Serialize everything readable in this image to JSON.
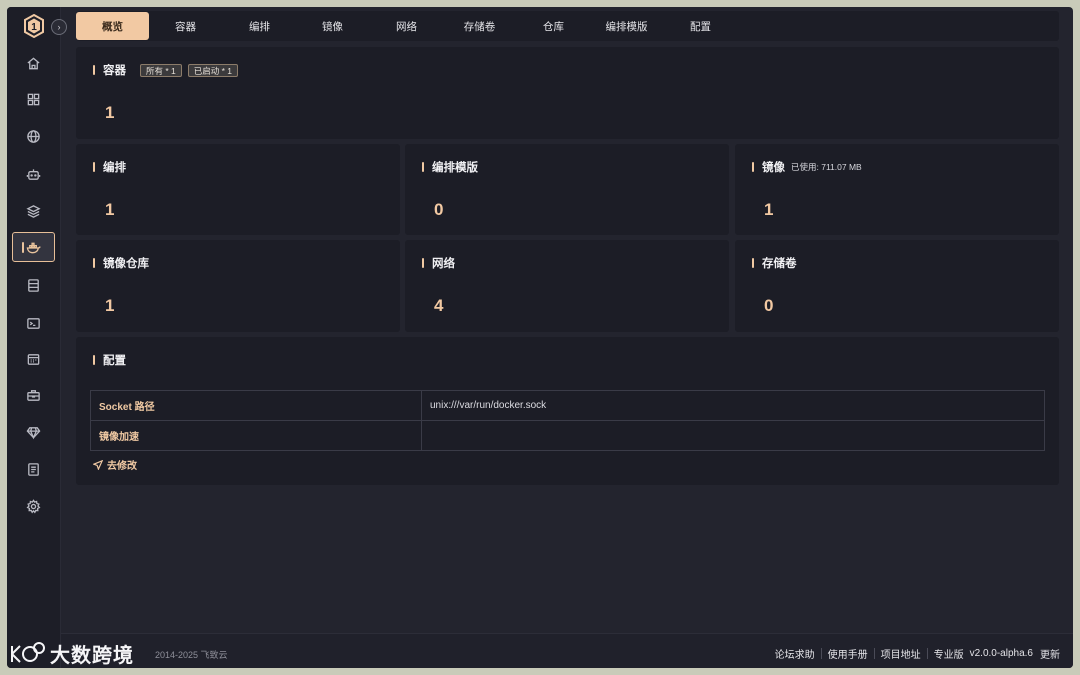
{
  "tabs": [
    "概览",
    "容器",
    "编排",
    "镜像",
    "网络",
    "存储卷",
    "仓库",
    "编排模版",
    "配置"
  ],
  "containers": {
    "title": "容器",
    "badge_all": "所有 * 1",
    "badge_running": "已启动 * 1",
    "value": "1"
  },
  "stats": {
    "stack": {
      "title": "编排",
      "value": "1"
    },
    "template": {
      "title": "编排模版",
      "value": "0"
    },
    "image": {
      "title": "镜像",
      "note": "已使用: 711.07 MB",
      "value": "1"
    },
    "registry": {
      "title": "镜像仓库",
      "value": "1"
    },
    "network": {
      "title": "网络",
      "value": "4"
    },
    "volume": {
      "title": "存储卷",
      "value": "0"
    }
  },
  "config": {
    "title": "配置",
    "rows": [
      {
        "key": "Socket 路径",
        "value": "unix:///var/run/docker.sock"
      },
      {
        "key": "镜像加速",
        "value": ""
      }
    ],
    "edit_label": "去修改"
  },
  "sidebar": {
    "icons": [
      "home-icon",
      "grid-icon",
      "globe-icon",
      "robot-icon",
      "layers-icon",
      "docker-icon",
      "server-icon",
      "terminal-icon",
      "calendar-icon",
      "toolbox-icon",
      "diamond-icon",
      "document-icon",
      "gear-icon"
    ],
    "active_index": 5
  },
  "footer": {
    "copyright": "2014-2025 飞致云",
    "links": [
      "论坛求助",
      "使用手册",
      "项目地址",
      "专业版"
    ],
    "version": "v2.0.0-alpha.6",
    "update": "更新"
  },
  "watermark": "大数跨境",
  "colors": {
    "accent": "#f2c9a3",
    "panel": "#1c1d26",
    "background": "#23242e"
  }
}
